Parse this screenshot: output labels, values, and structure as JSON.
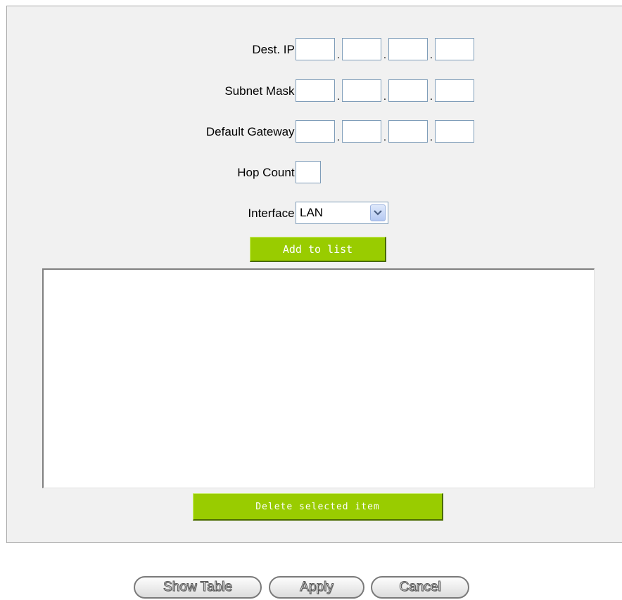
{
  "form": {
    "dest_ip_label": "Dest. IP :",
    "subnet_mask_label": "Subnet Mask :",
    "default_gateway_label": "Default Gateway :",
    "hop_count_label": "Hop Count :",
    "interface_label": "Interface :",
    "interface_value": "LAN",
    "dot": "."
  },
  "buttons": {
    "add_to_list": "Add to list",
    "delete_selected": "Delete selected item",
    "show_table": "Show Table",
    "apply": "Apply",
    "cancel": "Cancel"
  },
  "icons": {
    "dropdown": "chevron-down-icon"
  }
}
